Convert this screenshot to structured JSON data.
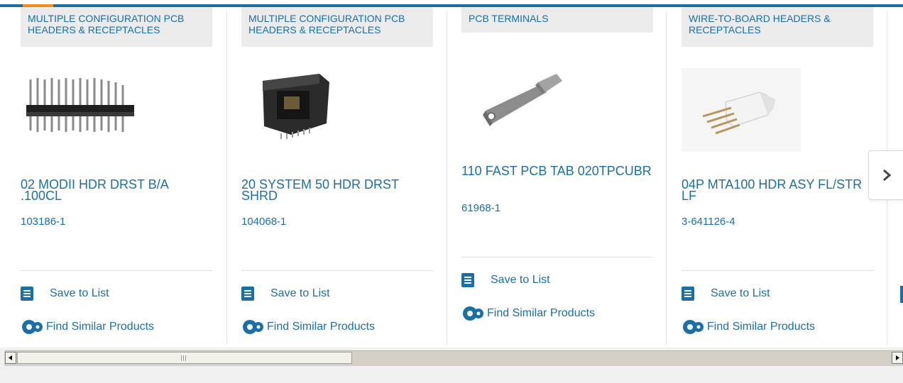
{
  "products": [
    {
      "category": "MULTIPLE CONFIGURATION PCB HEADERS & RECEPTACLES",
      "title": "02 MODII HDR DRST B/A .100CL",
      "part_number": "103186-1",
      "image": "pin-header-image",
      "save_label": "Save to List",
      "similar_label": "Find Similar Products"
    },
    {
      "category": "MULTIPLE CONFIGURATION PCB HEADERS & RECEPTACLES",
      "title": "20 SYSTEM 50 HDR DRST SHRD",
      "part_number": "104068-1",
      "image": "shrouded-header-image",
      "save_label": "Save to List",
      "similar_label": "Find Similar Products"
    },
    {
      "category": "PCB TERMINALS",
      "title": "110 FAST PCB TAB 020TPCUBR",
      "part_number": "61968-1",
      "image": "pcb-tab-image",
      "save_label": "Save to List",
      "similar_label": "Find Similar Products"
    },
    {
      "category": "WIRE-TO-BOARD HEADERS & RECEPTACLES",
      "title": "04P MTA100 HDR ASY FL/STR LF",
      "part_number": "3-641126-4",
      "image": "mta-header-image",
      "save_label": "Save to List",
      "similar_label": "Find Similar Products"
    }
  ],
  "carousel": {
    "next_icon": "chevron-right-icon"
  },
  "colors": {
    "accent": "#1a6fa8",
    "highlight": "#f28d1f",
    "category_bg": "#ebebeb"
  }
}
